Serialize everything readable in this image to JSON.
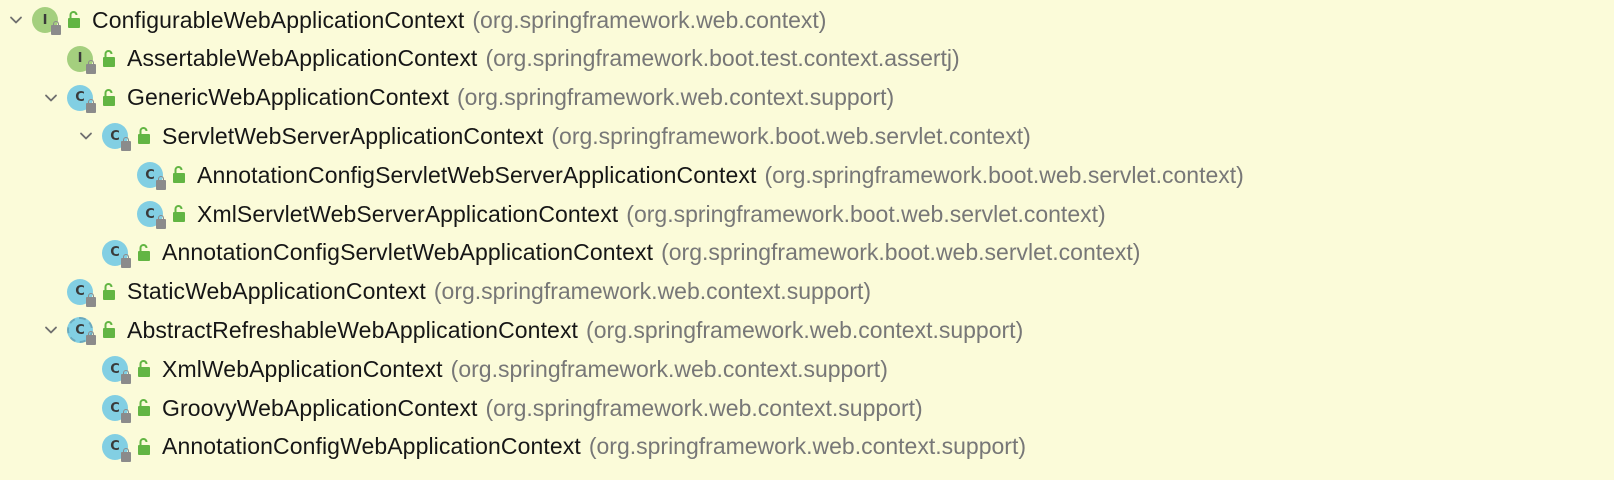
{
  "tree": {
    "nodes": [
      {
        "label": "ConfigurableWebApplicationContext",
        "package": "(org.springframework.web.context)",
        "kind": "interface",
        "depth": 0,
        "expanded": true,
        "icon_letter": "I"
      },
      {
        "label": "AssertableWebApplicationContext",
        "package": "(org.springframework.boot.test.context.assertj)",
        "kind": "interface",
        "depth": 1,
        "expanded": null,
        "icon_letter": "I"
      },
      {
        "label": "GenericWebApplicationContext",
        "package": "(org.springframework.web.context.support)",
        "kind": "class",
        "depth": 1,
        "expanded": true,
        "icon_letter": "C"
      },
      {
        "label": "ServletWebServerApplicationContext",
        "package": "(org.springframework.boot.web.servlet.context)",
        "kind": "class",
        "depth": 2,
        "expanded": true,
        "icon_letter": "C"
      },
      {
        "label": "AnnotationConfigServletWebServerApplicationContext",
        "package": "(org.springframework.boot.web.servlet.context)",
        "kind": "class",
        "depth": 3,
        "expanded": null,
        "icon_letter": "C"
      },
      {
        "label": "XmlServletWebServerApplicationContext",
        "package": "(org.springframework.boot.web.servlet.context)",
        "kind": "class",
        "depth": 3,
        "expanded": null,
        "icon_letter": "C"
      },
      {
        "label": "AnnotationConfigServletWebApplicationContext",
        "package": "(org.springframework.boot.web.servlet.context)",
        "kind": "class",
        "depth": 2,
        "expanded": null,
        "icon_letter": "C"
      },
      {
        "label": "StaticWebApplicationContext",
        "package": "(org.springframework.web.context.support)",
        "kind": "class",
        "depth": 1,
        "expanded": null,
        "icon_letter": "C"
      },
      {
        "label": "AbstractRefreshableWebApplicationContext",
        "package": "(org.springframework.web.context.support)",
        "kind": "abstract",
        "depth": 1,
        "expanded": true,
        "icon_letter": "C"
      },
      {
        "label": "XmlWebApplicationContext",
        "package": "(org.springframework.web.context.support)",
        "kind": "class",
        "depth": 2,
        "expanded": null,
        "icon_letter": "C"
      },
      {
        "label": "GroovyWebApplicationContext",
        "package": "(org.springframework.web.context.support)",
        "kind": "class",
        "depth": 2,
        "expanded": null,
        "icon_letter": "C"
      },
      {
        "label": "AnnotationConfigWebApplicationContext",
        "package": "(org.springframework.web.context.support)",
        "kind": "class",
        "depth": 2,
        "expanded": null,
        "icon_letter": "C"
      }
    ]
  },
  "icons": {
    "chevron": "chevron-down-icon",
    "interface": "interface-icon",
    "class": "class-icon",
    "abstract": "abstract-class-icon",
    "visibility": "public-visibility-icon",
    "lock": "lock-icon"
  },
  "colors": {
    "background": "#fbfbd9",
    "interface_badge": "#a4cf7e",
    "class_badge": "#82cfe3",
    "visibility_green": "#62b543",
    "label_text": "#161616",
    "package_text": "#777777",
    "chevron": "#6e6e6e"
  }
}
